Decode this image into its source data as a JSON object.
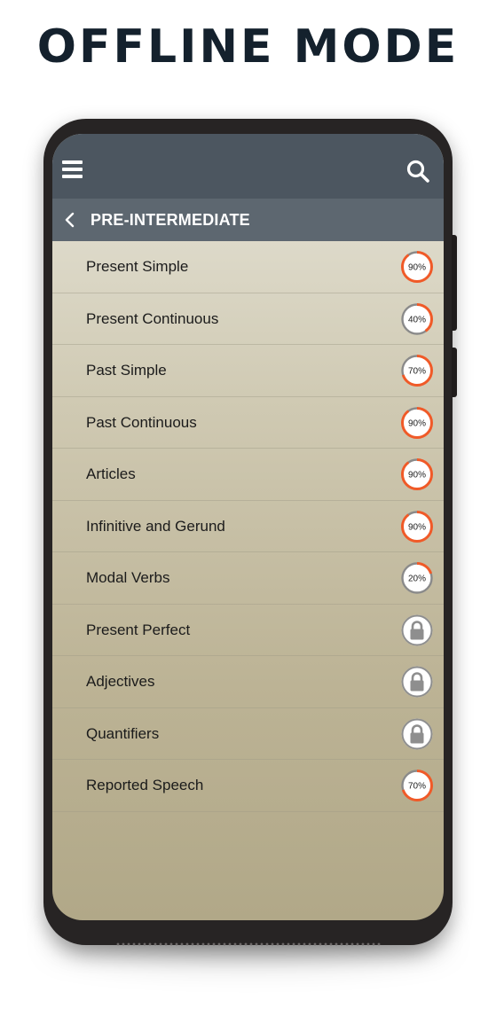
{
  "headline": "OFFLINE MODE",
  "appbar": {
    "menu_icon": "hamburger-menu-icon",
    "search_icon": "search-icon"
  },
  "subbar": {
    "back_icon": "chevron-left-icon",
    "title": "PRE-INTERMEDIATE"
  },
  "colors": {
    "appbar": "#4c5660",
    "subbar": "#5d6770",
    "progress": "#f05a28",
    "track": "#8a8a8a",
    "lock": "#8e8e8e"
  },
  "lessons": [
    {
      "label": "Present Simple",
      "progress": 90,
      "progress_text": "90%",
      "locked": false
    },
    {
      "label": "Present Continuous",
      "progress": 40,
      "progress_text": "40%",
      "locked": false
    },
    {
      "label": "Past Simple",
      "progress": 70,
      "progress_text": "70%",
      "locked": false
    },
    {
      "label": "Past Continuous",
      "progress": 90,
      "progress_text": "90%",
      "locked": false
    },
    {
      "label": "Articles",
      "progress": 90,
      "progress_text": "90%",
      "locked": false
    },
    {
      "label": "Infinitive and Gerund",
      "progress": 90,
      "progress_text": "90%",
      "locked": false
    },
    {
      "label": "Modal Verbs",
      "progress": 20,
      "progress_text": "20%",
      "locked": false
    },
    {
      "label": "Present Perfect",
      "locked": true
    },
    {
      "label": "Adjectives",
      "locked": true
    },
    {
      "label": "Quantifiers",
      "locked": true
    },
    {
      "label": "Reported Speech",
      "progress": 70,
      "progress_text": "70%",
      "locked": false
    }
  ]
}
